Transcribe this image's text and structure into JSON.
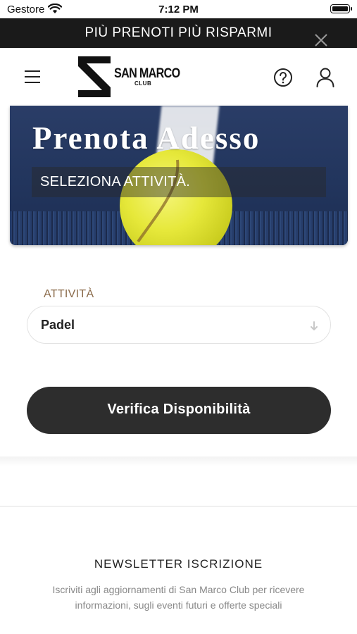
{
  "status_bar": {
    "carrier": "Gestore",
    "time": "7:12 PM"
  },
  "promo": {
    "text": "PIÙ PRENOTI PIÙ RISPARMI"
  },
  "header": {
    "logo_name": "SAN MARCO",
    "logo_sub": "CLUB"
  },
  "hero": {
    "title": "Prenota Adesso",
    "subtitle": "SELEZIONA ATTIVITÀ."
  },
  "form": {
    "activity_label": "ATTIVITÀ",
    "activity_value": "Padel",
    "verify_button": "Verifica Disponibilità"
  },
  "newsletter": {
    "title": "NEWSLETTER ISCRIZIONE",
    "text": "Iscriviti agli aggiornamenti di San Marco Club per ricevere informazioni, sugli eventi futuri e offerte speciali"
  },
  "colors": {
    "promo_bg": "#1a1a1a",
    "button_bg": "#2d2d2d",
    "label_accent": "#8a6a4a",
    "ball_yellow": "#e6e83a",
    "court_blue": "#22355d"
  },
  "icons": [
    "wifi-icon",
    "battery-icon",
    "close-icon",
    "menu-icon",
    "help-icon",
    "user-icon",
    "arrow-down-icon"
  ]
}
